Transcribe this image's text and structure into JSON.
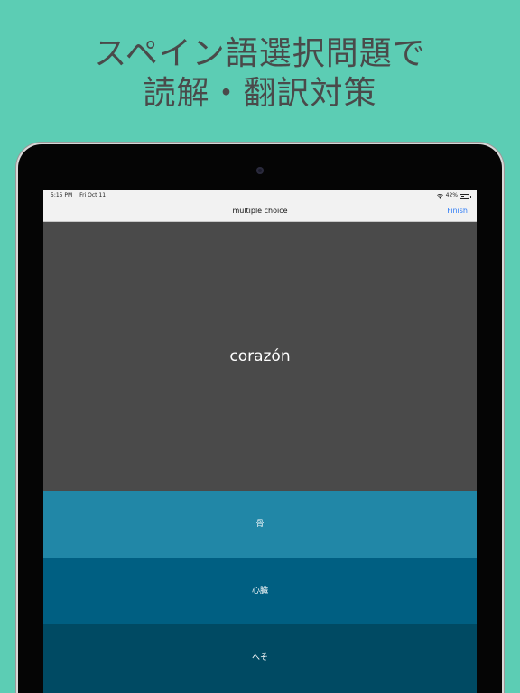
{
  "headline": {
    "line1": "スペイン語選択問題で",
    "line2": "読解・翻訳対策"
  },
  "status_bar": {
    "time": "5:15 PM",
    "date": "Fri Oct 11",
    "battery": "42%",
    "battery_level": 0.42
  },
  "nav": {
    "title": "multiple choice",
    "finish_label": "Finish"
  },
  "question": {
    "word": "corazón"
  },
  "choices": [
    {
      "label": "骨"
    },
    {
      "label": "心臓"
    },
    {
      "label": "へそ"
    }
  ],
  "colors": {
    "background": "#5ccdb4",
    "question_bg": "#4a4a4a",
    "choice_1": "#2187a7",
    "choice_2": "#005f82",
    "choice_3": "#004a63",
    "link": "#2f7cf6"
  }
}
